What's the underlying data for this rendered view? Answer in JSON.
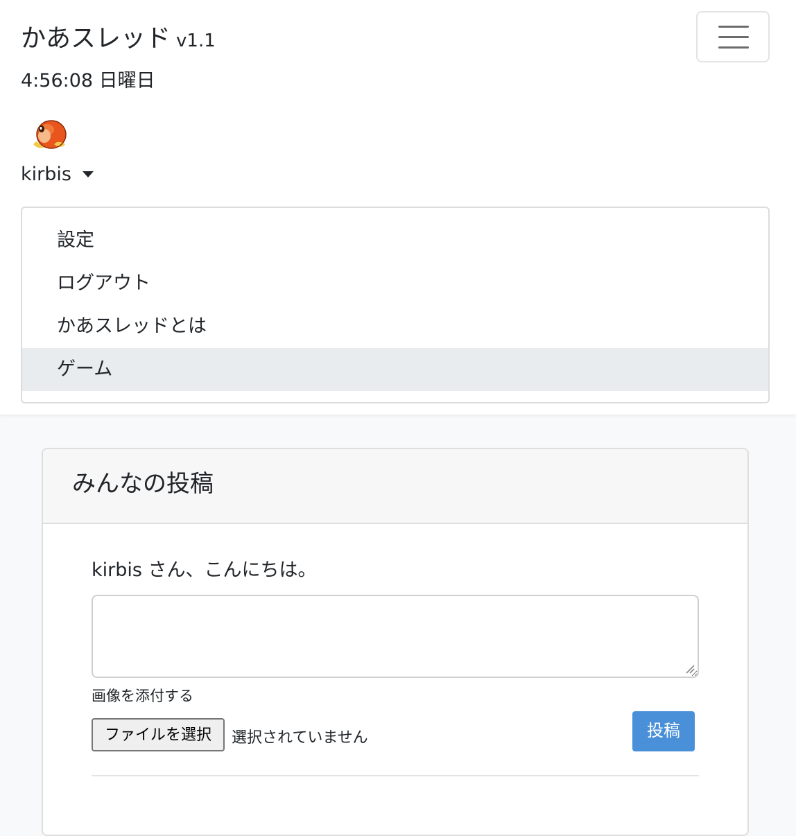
{
  "header": {
    "app_name": "かあスレッド",
    "version": "v1.1",
    "clock": "4:56:08 日曜日",
    "menu_icon": "hamburger-icon"
  },
  "user": {
    "name": "kirbis",
    "avatar_icon": "orange-character-avatar",
    "caret_icon": "caret-down-icon"
  },
  "dropdown": {
    "items": [
      {
        "label": "設定"
      },
      {
        "label": "ログアウト"
      },
      {
        "label": "かあスレッドとは"
      },
      {
        "label": "ゲーム",
        "active": true
      }
    ]
  },
  "card": {
    "title": "みんなの投稿",
    "greeting": "kirbis さん、こんにちは。",
    "post_text": "",
    "attach_label": "画像を添付する",
    "file_button": "ファイルを選択",
    "file_status": "選択されていません",
    "submit_label": "投稿"
  },
  "colors": {
    "primary": "#4a90d9",
    "active_item_bg": "#e9ecef",
    "page_bg": "#f8f9fa"
  }
}
